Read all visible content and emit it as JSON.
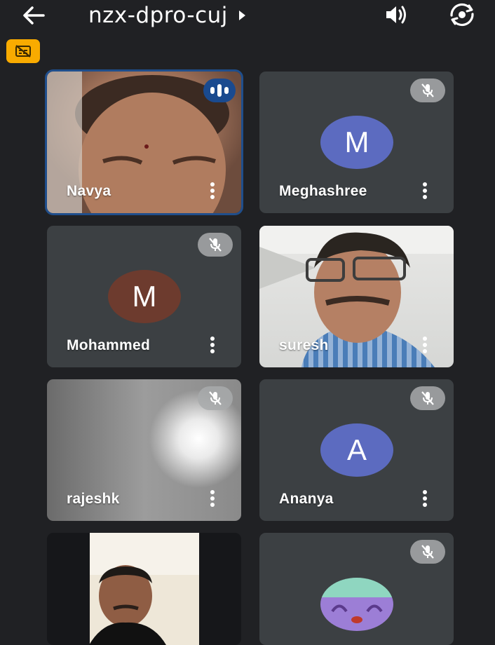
{
  "header": {
    "title": "nzx-dpro-cuj",
    "back_icon": "arrow-left-icon",
    "speaker_icon": "speaker-icon",
    "camera_flip_icon": "camera-flip-icon",
    "caption_badge_icon": "captions-off-icon",
    "caption_badge_color": "#f9ab00"
  },
  "participants": [
    {
      "name": "Navya",
      "type": "video",
      "speaking": true
    },
    {
      "name": "Meghashree",
      "type": "avatar",
      "initial": "M",
      "avatar_color": "#5c6bc0",
      "muted": true
    },
    {
      "name": "Mohammed",
      "type": "avatar",
      "initial": "M",
      "avatar_color": "#6d3b2e",
      "muted": true
    },
    {
      "name": "suresh",
      "type": "video",
      "muted": false
    },
    {
      "name": "rajeshk",
      "type": "video",
      "muted": true
    },
    {
      "name": "Ananya",
      "type": "avatar",
      "initial": "A",
      "avatar_color": "#5c6bc0",
      "muted": true
    },
    {
      "name": "",
      "type": "video"
    },
    {
      "name": "",
      "type": "avatar-image",
      "muted": true
    }
  ],
  "colors": {
    "background": "#202124",
    "tile": "#3c4043",
    "active_outline": "#1f4e8c"
  }
}
